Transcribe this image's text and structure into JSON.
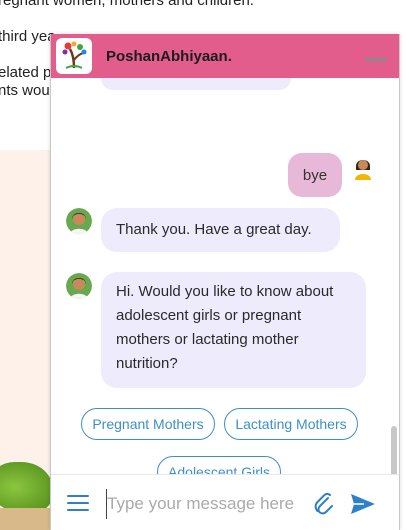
{
  "background": {
    "line1": "regnant women, mothers and children.",
    "line2": "third yea",
    "line3": "elated p",
    "line4": "nts wou"
  },
  "header": {
    "title": "PoshanAbhiyaan.",
    "color": "#e25d8c"
  },
  "messages": [
    {
      "from": "user",
      "text": "bye"
    },
    {
      "from": "bot",
      "text": "Thank you. Have a great day."
    },
    {
      "from": "bot",
      "text": "Hi. Would you like to know about adolescent girls or pregnant mothers or lactating mother nutrition?"
    }
  ],
  "quick_replies": [
    "Pregnant Mothers",
    "Lactating Mothers",
    "Adolescent Girls"
  ],
  "composer": {
    "placeholder": "Type your message here"
  },
  "icons": {
    "menu": "hamburger-menu-icon",
    "attach": "paperclip-icon",
    "send": "send-icon",
    "minimize": "minimize-icon"
  },
  "colors": {
    "bot_bubble": "#edebfc",
    "user_bubble": "#e8b8d8",
    "accent": "#2f80c8",
    "quick_reply": "#3d8fc9"
  }
}
